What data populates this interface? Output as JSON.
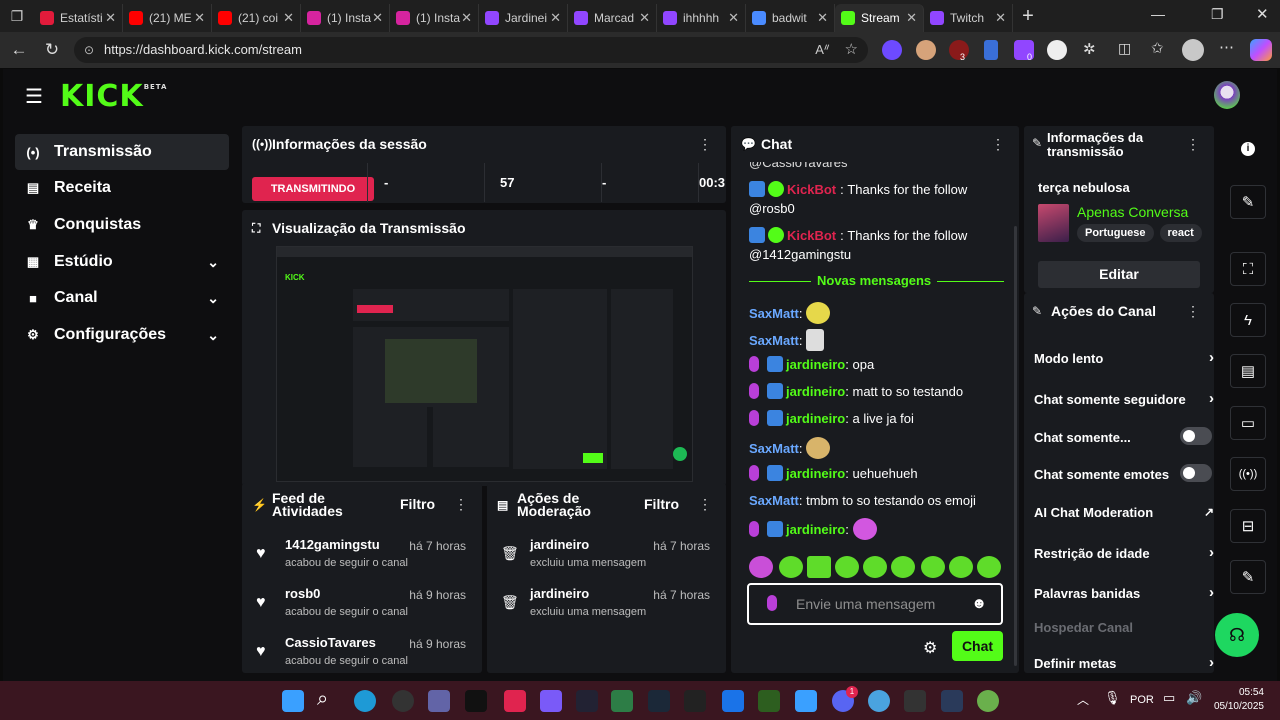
{
  "browser": {
    "tabs": [
      {
        "label": "Estatísti",
        "color": "#e21b3b"
      },
      {
        "label": "(21) ME",
        "color": "#ff0000"
      },
      {
        "label": "(21) coi",
        "color": "#ff0000"
      },
      {
        "label": "(1) Insta",
        "color": "#d6249f"
      },
      {
        "label": "(1) Insta",
        "color": "#d6249f"
      },
      {
        "label": "Jardinei",
        "color": "#9146ff"
      },
      {
        "label": "Marcad",
        "color": "#9146ff"
      },
      {
        "label": "ihhhhh",
        "color": "#9146ff"
      },
      {
        "label": "badwit",
        "color": "#4a8bff"
      },
      {
        "label": "Stream",
        "color": "#53fc18"
      },
      {
        "label": "Twitch",
        "color": "#9146ff"
      }
    ],
    "url": "https://dashboard.kick.com/stream",
    "ext_badge_1": "3",
    "ext_badge_2": "0"
  },
  "app": {
    "logo": "KICK",
    "logo_beta": "BETA",
    "sidebar": [
      {
        "label": "Transmissão",
        "icon": "broadcast-icon",
        "active": true
      },
      {
        "label": "Receita",
        "icon": "bar-chart-icon"
      },
      {
        "label": "Conquistas",
        "icon": "trophy-icon"
      },
      {
        "label": "Estúdio",
        "icon": "studio-icon",
        "expandable": true
      },
      {
        "label": "Canal",
        "icon": "channel-icon",
        "expandable": true
      },
      {
        "label": "Configurações",
        "icon": "gear-icon",
        "expandable": true
      }
    ],
    "session": {
      "title": "Informações da sessão",
      "status": "TRANSMITINDO",
      "stat1": "-",
      "stat2": "57",
      "stat3": "-",
      "stat4": "00:3"
    },
    "preview": {
      "title": "Visualização da Transmissão"
    },
    "feed": {
      "title": "Feed de Atividades",
      "filter": "Filtro",
      "items": [
        {
          "name": "1412gamingstu",
          "time": "há 7 horas",
          "desc": "acabou de seguir o canal"
        },
        {
          "name": "rosb0",
          "time": "há 9 horas",
          "desc": "acabou de seguir o canal"
        },
        {
          "name": "CassioTavares",
          "time": "há 9 horas",
          "desc": "acabou de seguir o canal"
        }
      ]
    },
    "moderation": {
      "title": "Ações de Moderação",
      "filter": "Filtro",
      "items": [
        {
          "name": "jardineiro",
          "time": "há 7 horas",
          "desc": "excluiu uma mensagem"
        },
        {
          "name": "jardineiro",
          "time": "há 7 horas",
          "desc": "excluiu uma mensagem"
        }
      ]
    },
    "chat": {
      "title": "Chat",
      "top_cut": "@CassioTavares",
      "kickbot1_user": "KickBot",
      "kickbot1_text": "Thanks for the follow",
      "kickbot1_mention": "@rosb0",
      "kickbot2_user": "KickBot",
      "kickbot2_text": "Thanks for the follow",
      "kickbot2_mention": "@1412gamingstu",
      "new_messages": "Novas mensagens",
      "m1_user": "SaxMatt",
      "m2_user": "SaxMatt",
      "m3_user": "jardineiro",
      "m3_text": "opa",
      "m4_user": "jardineiro",
      "m4_text": "matt to so testando",
      "m5_user": "jardineiro",
      "m5_text": "a live ja foi",
      "m6_user": "SaxMatt",
      "m7_user": "jardineiro",
      "m7_text": "uehuehueh",
      "m8_user": "SaxMatt",
      "m8_text": "tmbm to so testando os emoji",
      "m9_user": "jardineiro",
      "placeholder": "Envie uma mensagem",
      "send": "Chat"
    },
    "stream_info": {
      "title": "Informações da transmissão",
      "stream_title": "terça nebulosa",
      "category": "Apenas Conversa",
      "tags": [
        "Portuguese",
        "react"
      ],
      "edit": "Editar"
    },
    "channel_actions": {
      "title": "Ações do Canal",
      "items": [
        {
          "label": "Modo lento",
          "kind": "arrow"
        },
        {
          "label": "Chat somente seguidore",
          "kind": "arrow"
        },
        {
          "label": "Chat somente...",
          "kind": "toggle"
        },
        {
          "label": "Chat somente emotes",
          "kind": "toggle"
        },
        {
          "label": "AI Chat Moderation",
          "kind": "external"
        },
        {
          "label": "Restrição de idade",
          "kind": "arrow"
        },
        {
          "label": "Palavras banidas",
          "kind": "arrow"
        },
        {
          "label": "Hospedar Canal",
          "kind": "disabled"
        },
        {
          "label": "Definir metas",
          "kind": "arrow"
        }
      ]
    }
  },
  "taskbar": {
    "lang": "POR",
    "time": "05:54",
    "date": "05/10/2025",
    "discord_badge": "1"
  }
}
